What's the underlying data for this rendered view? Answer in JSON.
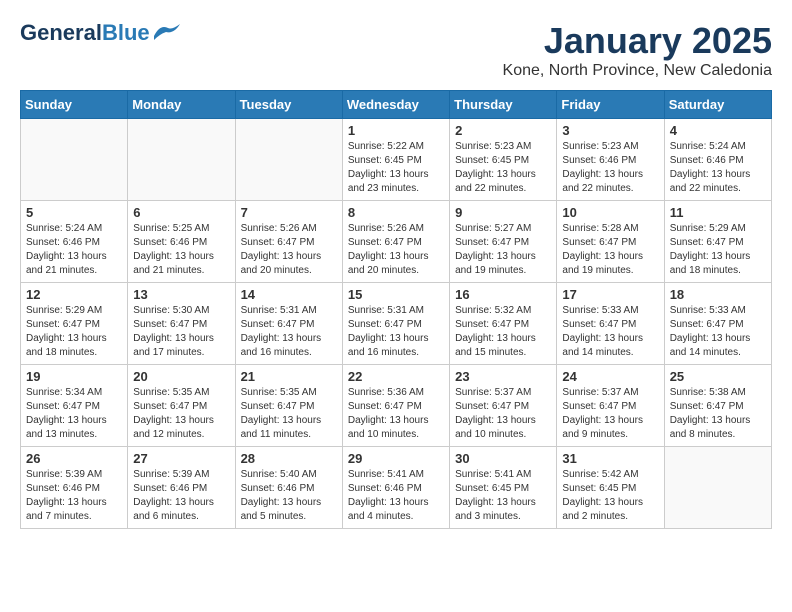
{
  "header": {
    "logo_general": "General",
    "logo_blue": "Blue",
    "month": "January 2025",
    "location": "Kone, North Province, New Caledonia"
  },
  "weekdays": [
    "Sunday",
    "Monday",
    "Tuesday",
    "Wednesday",
    "Thursday",
    "Friday",
    "Saturday"
  ],
  "weeks": [
    [
      {
        "day": "",
        "content": ""
      },
      {
        "day": "",
        "content": ""
      },
      {
        "day": "",
        "content": ""
      },
      {
        "day": "1",
        "content": "Sunrise: 5:22 AM\nSunset: 6:45 PM\nDaylight: 13 hours\nand 23 minutes."
      },
      {
        "day": "2",
        "content": "Sunrise: 5:23 AM\nSunset: 6:45 PM\nDaylight: 13 hours\nand 22 minutes."
      },
      {
        "day": "3",
        "content": "Sunrise: 5:23 AM\nSunset: 6:46 PM\nDaylight: 13 hours\nand 22 minutes."
      },
      {
        "day": "4",
        "content": "Sunrise: 5:24 AM\nSunset: 6:46 PM\nDaylight: 13 hours\nand 22 minutes."
      }
    ],
    [
      {
        "day": "5",
        "content": "Sunrise: 5:24 AM\nSunset: 6:46 PM\nDaylight: 13 hours\nand 21 minutes."
      },
      {
        "day": "6",
        "content": "Sunrise: 5:25 AM\nSunset: 6:46 PM\nDaylight: 13 hours\nand 21 minutes."
      },
      {
        "day": "7",
        "content": "Sunrise: 5:26 AM\nSunset: 6:47 PM\nDaylight: 13 hours\nand 20 minutes."
      },
      {
        "day": "8",
        "content": "Sunrise: 5:26 AM\nSunset: 6:47 PM\nDaylight: 13 hours\nand 20 minutes."
      },
      {
        "day": "9",
        "content": "Sunrise: 5:27 AM\nSunset: 6:47 PM\nDaylight: 13 hours\nand 19 minutes."
      },
      {
        "day": "10",
        "content": "Sunrise: 5:28 AM\nSunset: 6:47 PM\nDaylight: 13 hours\nand 19 minutes."
      },
      {
        "day": "11",
        "content": "Sunrise: 5:29 AM\nSunset: 6:47 PM\nDaylight: 13 hours\nand 18 minutes."
      }
    ],
    [
      {
        "day": "12",
        "content": "Sunrise: 5:29 AM\nSunset: 6:47 PM\nDaylight: 13 hours\nand 18 minutes."
      },
      {
        "day": "13",
        "content": "Sunrise: 5:30 AM\nSunset: 6:47 PM\nDaylight: 13 hours\nand 17 minutes."
      },
      {
        "day": "14",
        "content": "Sunrise: 5:31 AM\nSunset: 6:47 PM\nDaylight: 13 hours\nand 16 minutes."
      },
      {
        "day": "15",
        "content": "Sunrise: 5:31 AM\nSunset: 6:47 PM\nDaylight: 13 hours\nand 16 minutes."
      },
      {
        "day": "16",
        "content": "Sunrise: 5:32 AM\nSunset: 6:47 PM\nDaylight: 13 hours\nand 15 minutes."
      },
      {
        "day": "17",
        "content": "Sunrise: 5:33 AM\nSunset: 6:47 PM\nDaylight: 13 hours\nand 14 minutes."
      },
      {
        "day": "18",
        "content": "Sunrise: 5:33 AM\nSunset: 6:47 PM\nDaylight: 13 hours\nand 14 minutes."
      }
    ],
    [
      {
        "day": "19",
        "content": "Sunrise: 5:34 AM\nSunset: 6:47 PM\nDaylight: 13 hours\nand 13 minutes."
      },
      {
        "day": "20",
        "content": "Sunrise: 5:35 AM\nSunset: 6:47 PM\nDaylight: 13 hours\nand 12 minutes."
      },
      {
        "day": "21",
        "content": "Sunrise: 5:35 AM\nSunset: 6:47 PM\nDaylight: 13 hours\nand 11 minutes."
      },
      {
        "day": "22",
        "content": "Sunrise: 5:36 AM\nSunset: 6:47 PM\nDaylight: 13 hours\nand 10 minutes."
      },
      {
        "day": "23",
        "content": "Sunrise: 5:37 AM\nSunset: 6:47 PM\nDaylight: 13 hours\nand 10 minutes."
      },
      {
        "day": "24",
        "content": "Sunrise: 5:37 AM\nSunset: 6:47 PM\nDaylight: 13 hours\nand 9 minutes."
      },
      {
        "day": "25",
        "content": "Sunrise: 5:38 AM\nSunset: 6:47 PM\nDaylight: 13 hours\nand 8 minutes."
      }
    ],
    [
      {
        "day": "26",
        "content": "Sunrise: 5:39 AM\nSunset: 6:46 PM\nDaylight: 13 hours\nand 7 minutes."
      },
      {
        "day": "27",
        "content": "Sunrise: 5:39 AM\nSunset: 6:46 PM\nDaylight: 13 hours\nand 6 minutes."
      },
      {
        "day": "28",
        "content": "Sunrise: 5:40 AM\nSunset: 6:46 PM\nDaylight: 13 hours\nand 5 minutes."
      },
      {
        "day": "29",
        "content": "Sunrise: 5:41 AM\nSunset: 6:46 PM\nDaylight: 13 hours\nand 4 minutes."
      },
      {
        "day": "30",
        "content": "Sunrise: 5:41 AM\nSunset: 6:45 PM\nDaylight: 13 hours\nand 3 minutes."
      },
      {
        "day": "31",
        "content": "Sunrise: 5:42 AM\nSunset: 6:45 PM\nDaylight: 13 hours\nand 2 minutes."
      },
      {
        "day": "",
        "content": ""
      }
    ]
  ]
}
